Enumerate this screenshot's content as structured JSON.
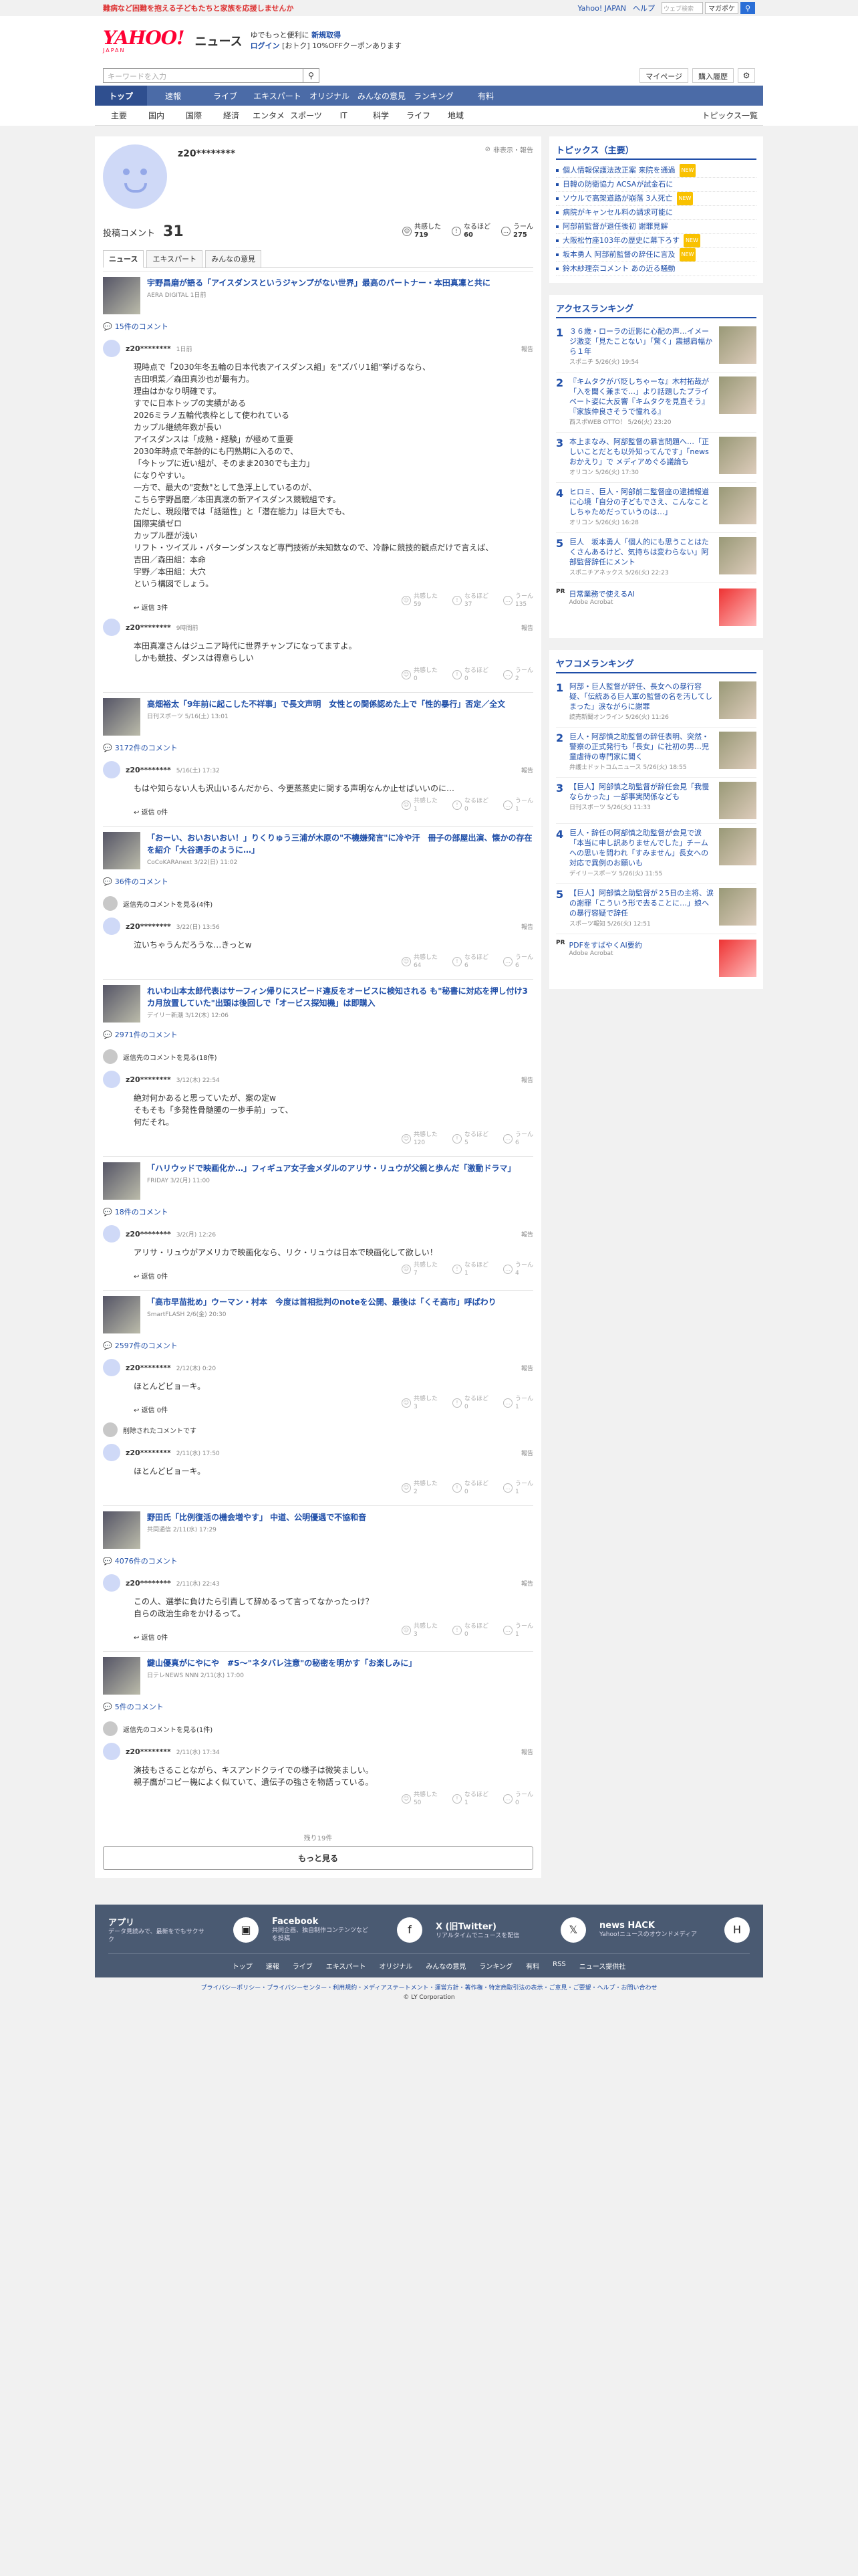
{
  "topbar": {
    "promo": "難病など困難を抱える子どもたちと家族を応援しませんか",
    "links": [
      "Yahoo! JAPAN",
      "ヘルプ"
    ],
    "search_placeholder": "ウェブ検索",
    "search_btn": "マガポケ"
  },
  "header": {
    "logo": "YAHOO!",
    "logo_sub": "JAPAN",
    "service": "ニュース",
    "promo1a": "ゆでもっと便利に",
    "promo1b": "新規取得",
    "promo2a": "ログイン",
    "promo2b": "[おトク] 10%OFFクーポンあります",
    "search_placeholder": "キーワードを入力",
    "mypage": "マイページ",
    "history": "購入履歴"
  },
  "nav1": [
    "トップ",
    "速報",
    "ライブ",
    "エキスパート",
    "オリジナル",
    "みんなの意見",
    "ランキング",
    "有料"
  ],
  "nav2": [
    "主要",
    "国内",
    "国際",
    "経済",
    "エンタメ",
    "スポーツ",
    "IT",
    "科学",
    "ライフ",
    "地域"
  ],
  "nav2_last": "トピックス一覧",
  "profile": {
    "name": "z20********",
    "hide_note": "非表示・報告",
    "total_label": "投稿コメント",
    "total": "31",
    "r1_label": "共感した",
    "r1": "719",
    "r2_label": "なるほど",
    "r2": "60",
    "r3_label": "うーん",
    "r3": "275"
  },
  "tabs": [
    "ニュース",
    "エキスパート",
    "みんなの意見"
  ],
  "ui": {
    "report": "報告",
    "agree": "共感した",
    "naruhodo": "なるほど",
    "hmm": "うーん",
    "remaining": "残り19件",
    "more": "もっと見る"
  },
  "cards": [
    {
      "title": "宇野昌磨が語る「アイスダンスというジャンプがない世界」最高のパートナー・本田真凜と共に",
      "src": "AERA DIGITAL 1日前",
      "count": "15件のコメント",
      "comments": [
        {
          "user": "z20********",
          "date": "1日前",
          "body": "現時点で「2030年冬五輪の日本代表アイスダンス組」を\"ズバリ1組\"挙げるなら、\n吉田唄菜／森田真沙也が最有力。\n理由はかなり明確です。\nすでに日本トップの実績がある\n2026ミラノ五輪代表枠として使われている\nカップル継続年数が長い\nアイスダンスは「成熟・経験」が極めて重要\n2030年時点で年齢的にも円熟期に入るので、\n「今トップに近い組が、そのまま2030でも主力」\nになりやすい。\n一方で、最大の\"変数\"として急浮上しているのが、\nこちら宇野昌磨／本田真凜の新アイスダンス競戦組です。\nただし、現段階では「話題性」と「潜在能力」は巨大でも、\n国際実績ゼロ\nカップル歴が浅い\nリフト・ツイズル・パターンダンスなど専門技術が未知数なので、冷静に競技的観点だけで言えば、\n吉田／森田組：本命\n宇野／本田組：大穴\nという構図でしょう。",
          "a": "59",
          "b": "37",
          "c": "135",
          "replies": "返信 3件"
        },
        {
          "user": "z20********",
          "date": "9時間前",
          "body": "本田真凜さんはジュニア時代に世界チャンプになってますよ。\nしかも競技、ダンスは得意らしい",
          "a": "0",
          "b": "0",
          "c": "2",
          "replies": ""
        }
      ]
    },
    {
      "title": "高畑裕太「9年前に起こした不祥事」で長文声明　女性との関係認めた上で「性的暴行」否定／全文",
      "src": "日刊スポーツ 5/16(土) 13:01",
      "count": "3172件のコメント",
      "comments": [
        {
          "user": "z20********",
          "date": "5/16(土) 17:32",
          "body": "もはや知らない人も沢山いるんだから、今更蒸蒸史に関する声明なんか止せばいいのに…",
          "a": "1",
          "b": "0",
          "c": "1",
          "replies": "返信 0件"
        }
      ]
    },
    {
      "title": "「おーい、おいおいおい！」りくりゅう三浦が木原の\"不機嫌発言\"に冷や汗　冊子の部屋出演、懐かの存在を紹介「大谷選手のように…」",
      "src": "CoCoKARAnext 3/22(日) 11:02",
      "count": "36件のコメント",
      "comments": [
        {
          "user": "z20********",
          "date": "3/22(日) 13:56",
          "body": "泣いちゃうんだろうな…きっとw",
          "a": "64",
          "b": "6",
          "c": "6",
          "replies": "",
          "pre": "返信先のコメントを見る(4件)"
        }
      ]
    },
    {
      "title": "れいわ山本太郎代表はサーフィン帰りにスピード違反をオービスに検知される も\"秘書に対応を押し付け3カ月放置していた\"出頭は後回しで「オービス探知機」は即購入",
      "src": "デイリー新潮 3/12(木) 12:06",
      "count": "2971件のコメント",
      "comments": [
        {
          "user": "z20********",
          "date": "3/12(木) 22:54",
          "body": "絶対何かあると思っていたが、案の定w\nそもそも「多発性骨髄腫の一歩手前」って、\n何だそれ。",
          "a": "120",
          "b": "5",
          "c": "6",
          "replies": "",
          "pre": "返信先のコメントを見る(18件)"
        }
      ]
    },
    {
      "title": "「ハリウッドで映画化か…」フィギュア女子金メダルのアリサ・リュウが父親と歩んだ「激動ドラマ」",
      "src": "FRIDAY 3/2(月) 11:00",
      "count": "18件のコメント",
      "comments": [
        {
          "user": "z20********",
          "date": "3/2(月) 12:26",
          "body": "アリサ・リュウがアメリカで映画化なら、リク・リュウは日本で映画化して欲しい！",
          "a": "7",
          "b": "1",
          "c": "4",
          "replies": "返信 0件"
        }
      ]
    },
    {
      "title": "「高市早苗批め」ウーマン・村本　今度は首相批判のnoteを公開、最後は「くそ高市」呼ばわり",
      "src": "SmartFLASH 2/6(金) 20:30",
      "count": "2597件のコメント",
      "comments": [
        {
          "user": "z20********",
          "date": "2/12(木) 0:20",
          "body": "ほとんどビョーキ。",
          "a": "3",
          "b": "0",
          "c": "1",
          "replies": "返信 0件"
        },
        {
          "user": "z20********",
          "date": "2/11(水) 17:50",
          "body": "ほとんどビョーキ。",
          "a": "2",
          "b": "0",
          "c": "1",
          "replies": "",
          "pre": "削除されたコメントです"
        }
      ]
    },
    {
      "title": "野田氏「比例復活の機会増やす」 中道、公明優遇で不協和音",
      "src": "共同通信 2/11(水) 17:29",
      "count": "4076件のコメント",
      "comments": [
        {
          "user": "z20********",
          "date": "2/11(水) 22:43",
          "body": "この人、選挙に負けたら引責して辞めるって言ってなかったっけ？\n自らの政治生命をかけるって。",
          "a": "3",
          "b": "0",
          "c": "1",
          "replies": "返信 0件"
        }
      ]
    },
    {
      "title": "鍵山優真がにやにや　#S〜\"ネタバレ注意\"の秘密を明かす「お楽しみに」",
      "src": "日テレNEWS NNN 2/11(水) 17:00",
      "count": "5件のコメント",
      "comments": [
        {
          "user": "z20********",
          "date": "2/11(水) 17:34",
          "body": "演技もさることながら、キスアンドクライでの様子は微笑ましい。\n親子鷹がコピー機によく似ていて、遺伝子の強さを物語っている。",
          "a": "50",
          "b": "1",
          "c": "0",
          "replies": "",
          "pre": "返信先のコメントを見る(1件)"
        }
      ]
    }
  ],
  "side": {
    "topics_title": "トピックス（主要）",
    "topics": [
      {
        "t": "個人情報保護法改正案 来院を通過",
        "n": "NEW"
      },
      {
        "t": "日韓の防衛協力 ACSAが試金石に",
        "n": ""
      },
      {
        "t": "ソウルで高架道路が崩落 3人死亡",
        "n": "NEW"
      },
      {
        "t": "病院がキャンセル料の請求可能に",
        "n": ""
      },
      {
        "t": "阿部前監督が退任後初 謝罪見解",
        "n": ""
      },
      {
        "t": "大阪松竹座103年の歴史に幕下ろす",
        "n": "NEW"
      },
      {
        "t": "坂本勇人 阿部前監督の辞任に言及",
        "n": "NEW"
      },
      {
        "t": "鈴木紗理奈コメント あの近る騒動",
        "n": ""
      }
    ],
    "access_title": "アクセスランキング",
    "access": [
      {
        "t": "３６歳・ローラの近影に心配の声…イメージ激変「見たことない」「驚く」震撼肩幅から１年",
        "s": "スポニチ 5/26(火) 19:54"
      },
      {
        "t": "『キムタクがバ貶しちゃーな』木村拓哉が「入を聞く兼まで…」より話題したプライベート姿に大反響『キムタクを見直そう』『家族仲良さそうで憧れる』",
        "s": "西スポWEB OTTO！ 5/26(火) 23:20"
      },
      {
        "t": "本上まなみ、阿部監督の暴言問題へ…「正しいことだとも以外知ってんです」「news おかえり」で メディアめぐる議論も",
        "s": "オリコン 5/26(火) 17:30"
      },
      {
        "t": "ヒロミ、巨人・阿部前二監督座の逮捕報道に心境「自分の子どもでさえ、こんなことしちゃためだっていうのは…」",
        "s": "オリコン 5/26(火) 16:28"
      },
      {
        "t": "巨人　坂本勇人「個人的にも思うことはたくさんあるけど、気持ちは変わらない」阿部監督辞任にメント",
        "s": "スポニチアネックス 5/26(火) 22:23"
      }
    ],
    "ad1": {
      "tag": "PR",
      "t": "日常業務で使えるAI",
      "s": "Adobe Acrobat"
    },
    "yafoo_title": "ヤフコメランキング",
    "yafoo": [
      {
        "t": "阿部・巨人監督が辞任、長女への暴行容疑、「伝統ある巨人軍の監督の名を汚してしまった」涙ながらに謝罪",
        "s": "読売新聞オンライン 5/26(火) 11:26"
      },
      {
        "t": "巨人・阿部慎之助監督の辞任表明、突然・警察の正式発行も「長女」に社初の男…児童虐待の専門家に聞く",
        "s": "弁護士ドットコムニュース 5/26(火) 18:55"
      },
      {
        "t": "【巨人】阿部慎之助監督が辞任会見「我慢ならかった」一部事実関係なども",
        "s": "日刊スポーツ 5/26(火) 11:33"
      },
      {
        "t": "巨人・辞任の阿部慎之助監督が会見で涙「本当に申し訳ありませんでした」チームへの思いを問われ「すみません」長女への対応で異例のお願いも",
        "s": "デイリースポーツ 5/26(火) 11:55"
      },
      {
        "t": "【巨人】阿部慎之助監督が２5日の主将、涙の謝罪「こういう形で去ることに…」娘への暴行容疑で辞任",
        "s": "スポーツ報知 5/26(火) 12:51"
      }
    ],
    "ad2": {
      "tag": "PR",
      "t": "PDFをすばやくAI要約",
      "s": "Adobe Acrobat"
    }
  },
  "footer": {
    "apps": [
      {
        "name": "アプリ",
        "desc": "データ見読みで、最新をでもサクサク",
        "ic": "▣"
      },
      {
        "name": "Facebook",
        "desc": "共同企画、独自制作コンテンツなどを投稿",
        "ic": "f"
      },
      {
        "name": "X (旧Twitter)",
        "desc": "リアルタイムでニュースを配信",
        "ic": "𝕏"
      },
      {
        "name": "news HACK",
        "desc": "Yahoo!ニュースのオウンドメディア",
        "ic": "H"
      }
    ],
    "nav": [
      "トップ",
      "速報",
      "ライブ",
      "エキスパート",
      "オリジナル",
      "みんなの意見",
      "ランキング",
      "有料",
      "RSS",
      "ニュース提供社"
    ],
    "links": "プライバシーポリシー・プライバシーセンター・利用規約・メディアステートメント・運営方針・著作権・特定商取引法の表示・ご意見・ご要望・ヘルプ・お問い合わせ",
    "copy": "© LY Corporation"
  }
}
